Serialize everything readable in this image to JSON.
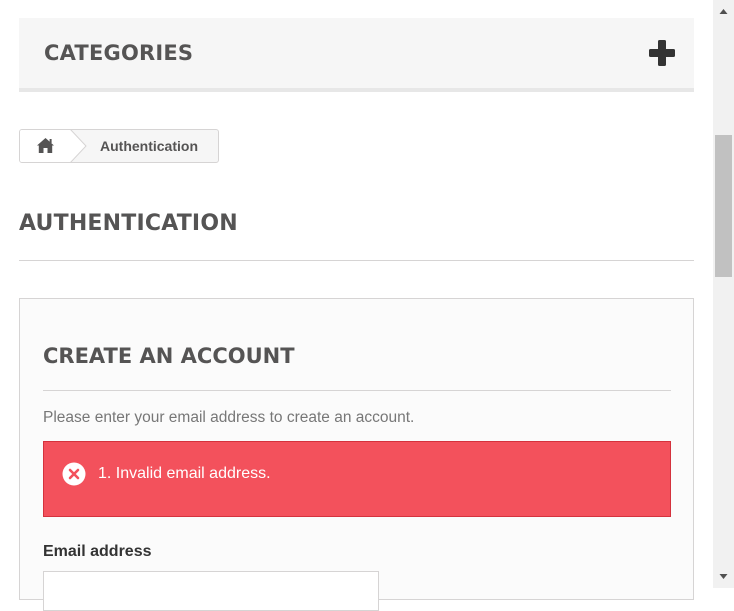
{
  "categories": {
    "title": "CATEGORIES",
    "expand_icon": "plus-icon"
  },
  "breadcrumb": {
    "home_icon": "home-icon",
    "current": "Authentication"
  },
  "page_heading": "AUTHENTICATION",
  "create_account": {
    "title": "CREATE AN ACCOUNT",
    "description": "Please enter your email address to create an account.",
    "alert": {
      "icon": "error-circle-icon",
      "message": "1. Invalid email address.",
      "color": "#f3515c"
    },
    "email_label": "Email address",
    "email_value": ""
  },
  "scrollbar": {
    "up_icon": "triangle-up-icon",
    "down_icon": "triangle-down-icon"
  }
}
